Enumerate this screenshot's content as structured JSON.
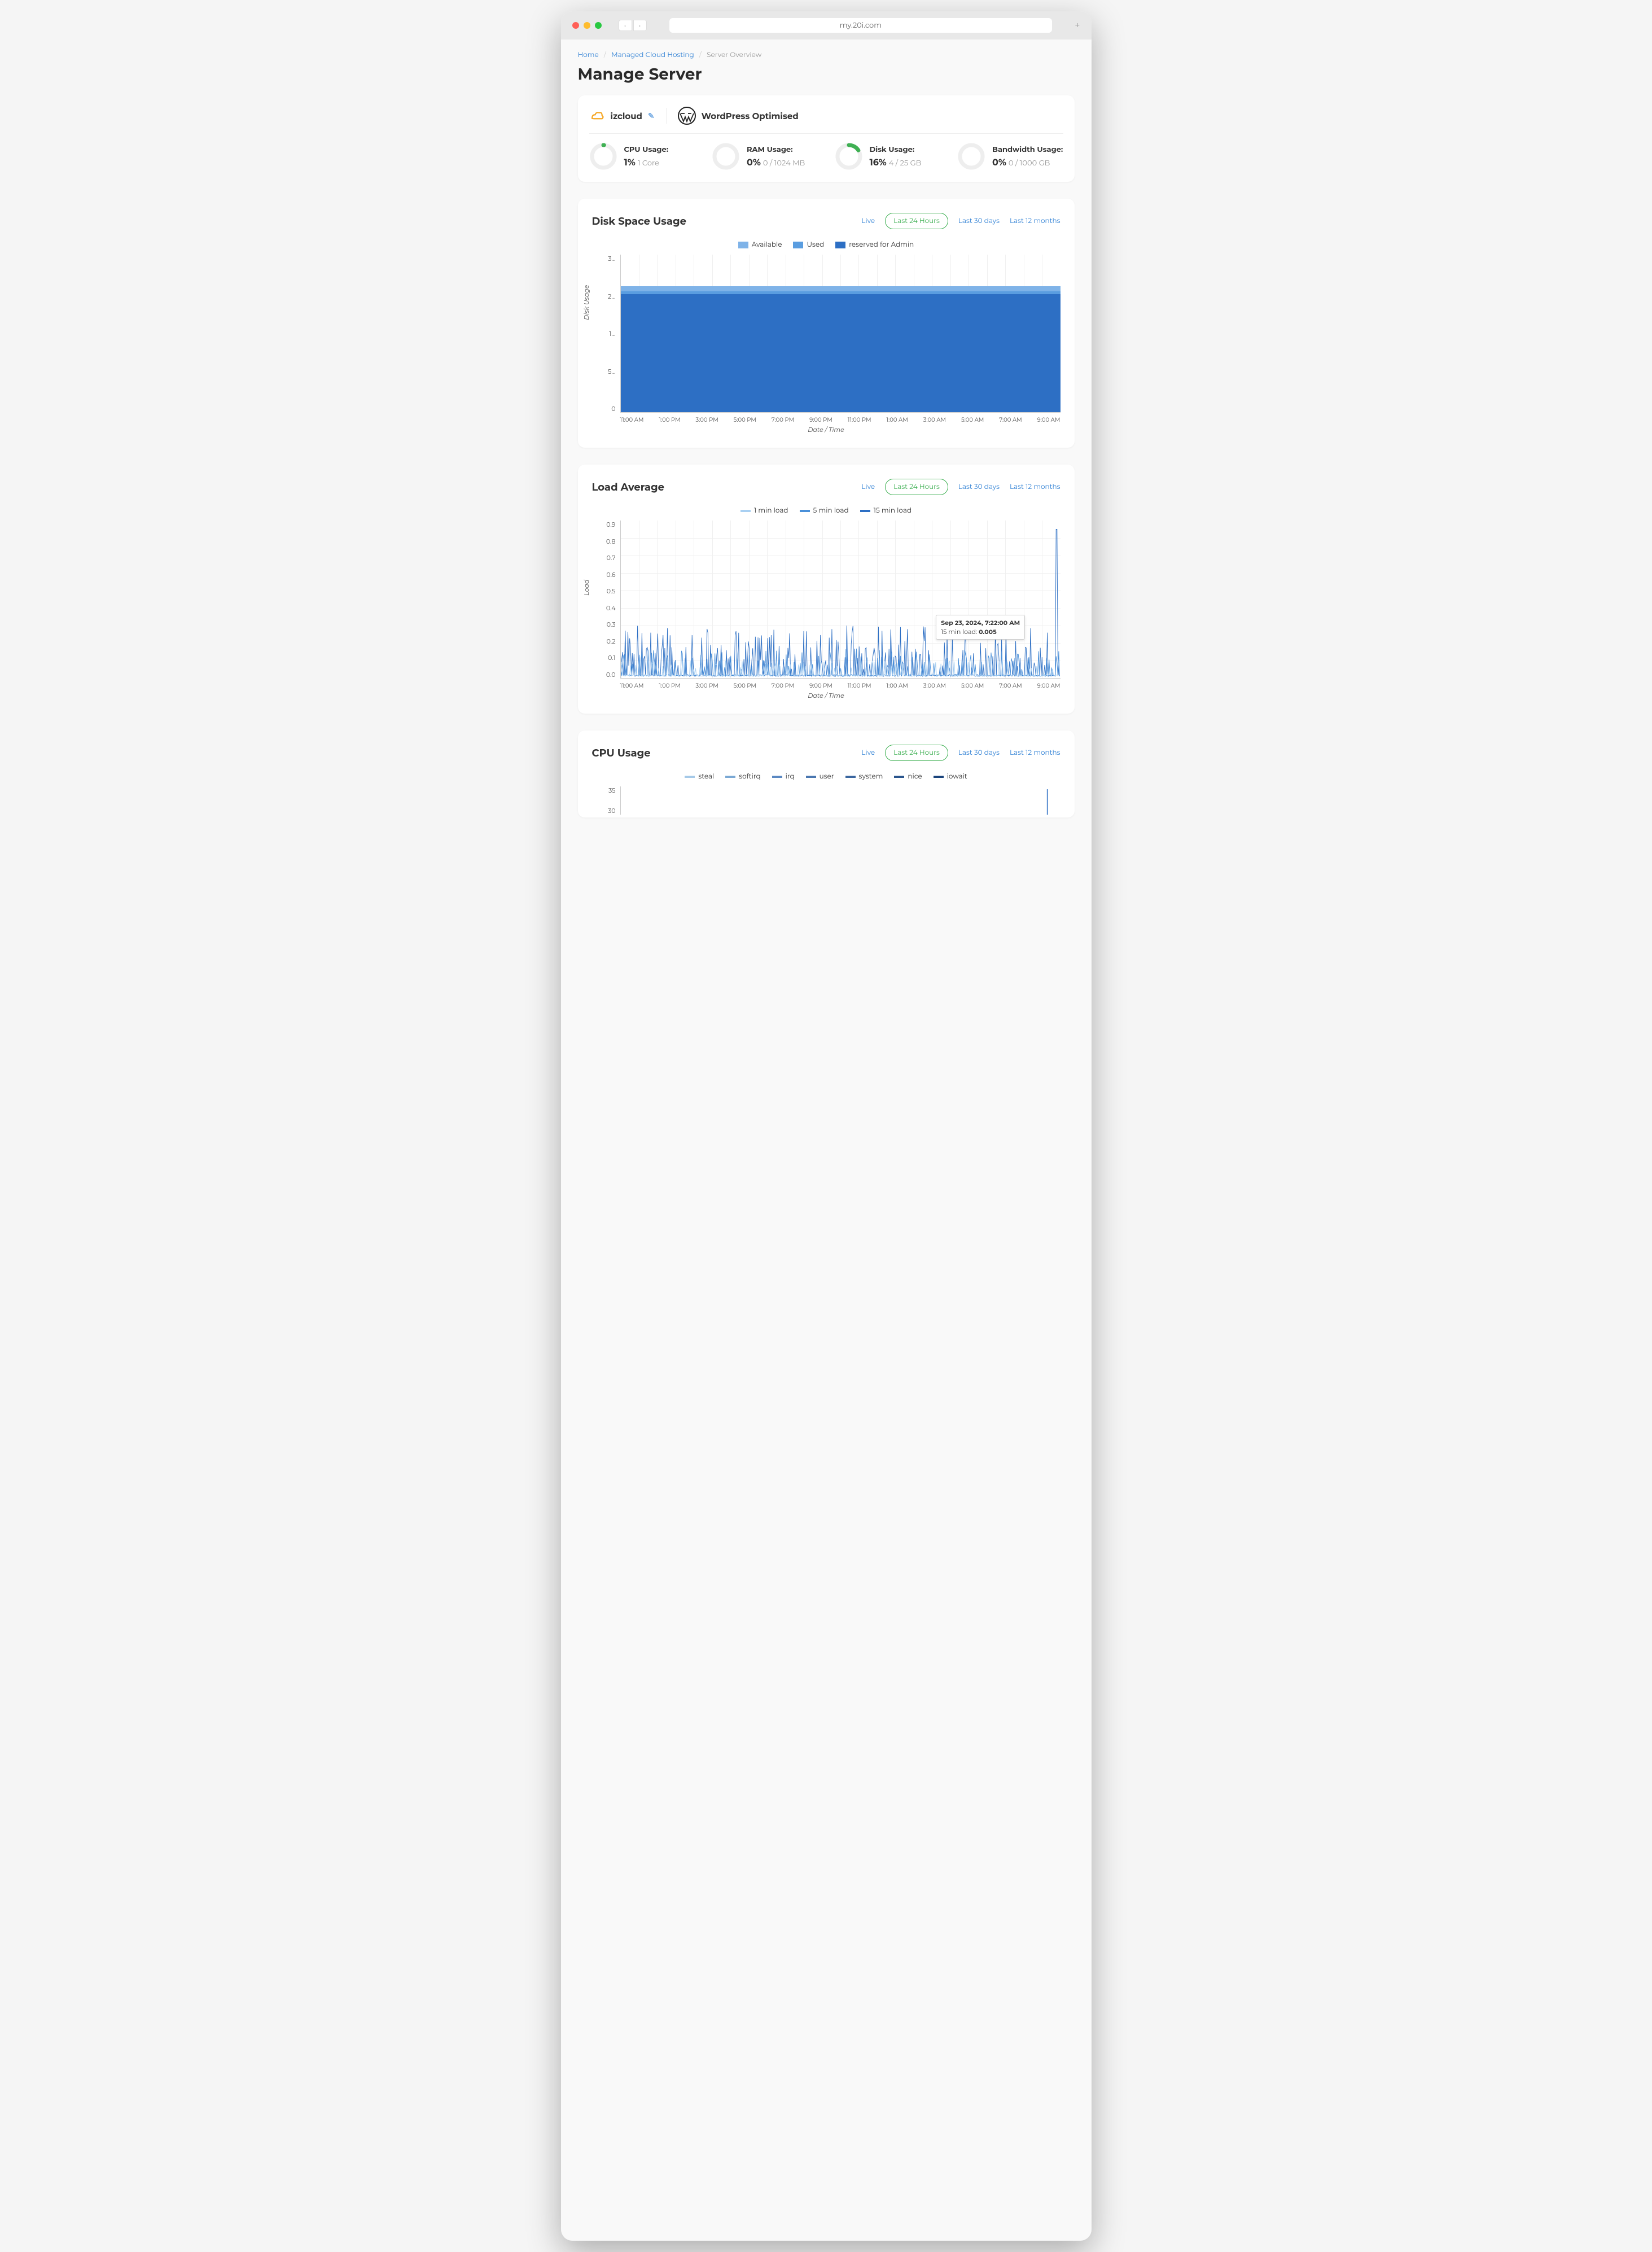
{
  "url": "my.20i.com",
  "breadcrumb": {
    "home": "Home",
    "managed": "Managed Cloud Hosting",
    "current": "Server Overview"
  },
  "page_title": "Manage Server",
  "server": {
    "name": "izcloud",
    "optimised": "WordPress Optimised"
  },
  "stats": {
    "cpu": {
      "label": "CPU Usage:",
      "pct": "1%",
      "sub": "1 Core",
      "fill": 1
    },
    "ram": {
      "label": "RAM Usage:",
      "pct": "0%",
      "sub": "0 / 1024 MB",
      "fill": 0
    },
    "disk": {
      "label": "Disk Usage:",
      "pct": "16%",
      "sub": "4 / 25 GB",
      "fill": 16
    },
    "bw": {
      "label": "Bandwidth Usage:",
      "pct": "0%",
      "sub": "0 / 1000 GB",
      "fill": 0
    }
  },
  "filters": {
    "live": "Live",
    "h24": "Last 24 Hours",
    "d30": "Last 30 days",
    "m12": "Last 12 months"
  },
  "chart_data": [
    {
      "id": "disk",
      "title": "Disk Space Usage",
      "type": "area",
      "ylabel": "Disk Usage",
      "xlabel": "Date / Time",
      "ylim": [
        0,
        3
      ],
      "y_ticks": [
        "3…",
        "2…",
        "1…",
        "5…",
        "0"
      ],
      "legend": [
        {
          "name": "Available",
          "color": "#7fb3e8"
        },
        {
          "name": "Used",
          "color": "#5a9de0"
        },
        {
          "name": "reserved for Admin",
          "color": "#2d6fc4"
        }
      ],
      "categories": [
        "11:00 AM",
        "1:00 PM",
        "3:00 PM",
        "5:00 PM",
        "7:00 PM",
        "9:00 PM",
        "11:00 PM",
        "1:00 AM",
        "3:00 AM",
        "5:00 AM",
        "7:00 AM",
        "9:00 AM"
      ],
      "stacked_heights": {
        "available": 2.4,
        "used": 2.3,
        "reserved": 2.25,
        "note": "constant across all timestamps"
      }
    },
    {
      "id": "load",
      "title": "Load Average",
      "type": "line",
      "ylabel": "Load",
      "xlabel": "Date / Time",
      "ylim": [
        0,
        0.9
      ],
      "y_ticks": [
        "0.9",
        "0.8",
        "0.7",
        "0.6",
        "0.5",
        "0.4",
        "0.3",
        "0.2",
        "0.1",
        "0.0"
      ],
      "legend": [
        {
          "name": "1 min load",
          "color": "#a9d0f2"
        },
        {
          "name": "5 min load",
          "color": "#4a90d9"
        },
        {
          "name": "15 min load",
          "color": "#2d6fc4"
        }
      ],
      "categories": [
        "11:00 AM",
        "1:00 PM",
        "3:00 PM",
        "5:00 PM",
        "7:00 PM",
        "9:00 PM",
        "11:00 PM",
        "1:00 AM",
        "3:00 AM",
        "5:00 AM",
        "7:00 AM",
        "9:00 AM"
      ],
      "tooltip": {
        "ts": "Sep 23, 2024, 7:22:00 AM",
        "label": "15 min load:",
        "value": "0.005"
      },
      "note": "highly spiky; typical baseline near 0 with frequent spikes to 0.1–0.3, occasional to 0.85 near end"
    },
    {
      "id": "cpu",
      "title": "CPU Usage",
      "type": "line",
      "ylabel": "",
      "xlabel": "",
      "ylim": [
        30,
        35
      ],
      "y_ticks": [
        "35",
        "30"
      ],
      "legend": [
        {
          "name": "steal",
          "color": "#a5c9e8"
        },
        {
          "name": "softirq",
          "color": "#7aa8d4"
        },
        {
          "name": "irq",
          "color": "#5a88c2"
        },
        {
          "name": "user",
          "color": "#4a77b0"
        },
        {
          "name": "system",
          "color": "#3a669f"
        },
        {
          "name": "nice",
          "color": "#2a558d"
        },
        {
          "name": "iowait",
          "color": "#1a447c"
        }
      ],
      "categories": []
    }
  ]
}
